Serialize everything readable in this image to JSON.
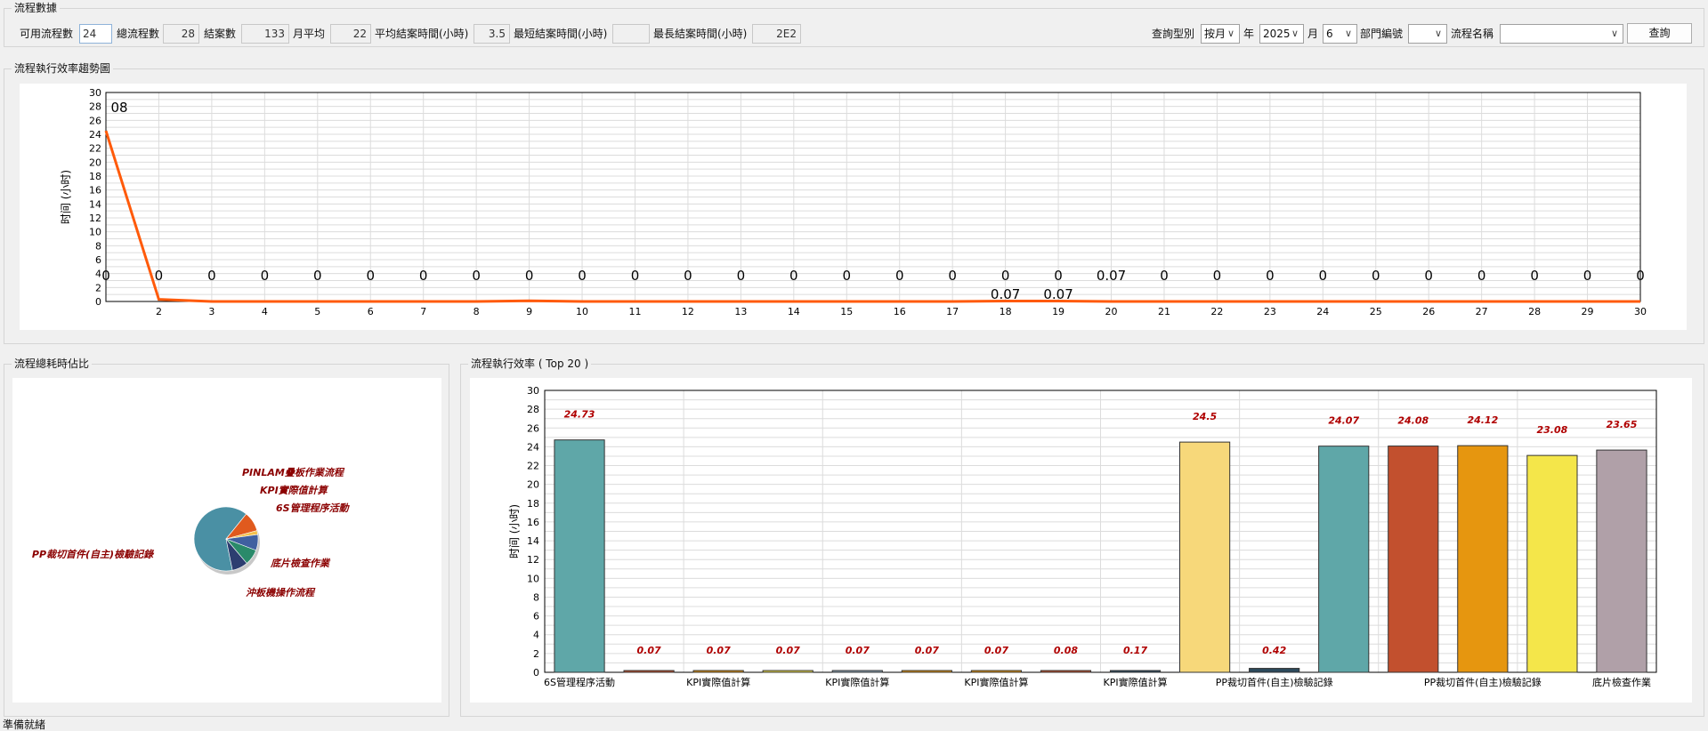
{
  "stats": {
    "title": "流程數據",
    "available_label": "可用流程數",
    "available_value": "24",
    "total_label": "總流程數",
    "total_value": "28",
    "closed_label": "結案數",
    "closed_value": "133",
    "monthly_label": "月平均",
    "monthly_value": "22",
    "avg_label": "平均結案時間(小時)",
    "avg_value": "3.5",
    "min_label": "最短結案時間(小時)",
    "min_value": "",
    "max_label": "最長結案時間(小時)",
    "max_value": "2E2"
  },
  "query": {
    "type_label": "查詢型別",
    "type_value": "按月",
    "year_label": "年",
    "year_value": "2025",
    "month_label": "月",
    "month_value": "6",
    "dept_label": "部門編號",
    "dept_value": "",
    "name_label": "流程名稱",
    "name_value": "",
    "search_button": "查詢"
  },
  "trend_section": {
    "title": "流程執行效率趨勢圖"
  },
  "pie_section": {
    "title": "流程總耗時佔比"
  },
  "bar_section": {
    "title": "流程執行效率 ( Top 20 )"
  },
  "status_bar": {
    "text": "準備就緒"
  },
  "chart_data": [
    {
      "type": "line",
      "ylabel": "时间 (小时)",
      "ylim": [
        0,
        30
      ],
      "yticks": [
        0,
        2,
        4,
        6,
        8,
        10,
        12,
        14,
        16,
        18,
        20,
        22,
        24,
        26,
        28,
        30
      ],
      "x_tick_labels": [
        "2",
        "3",
        "4",
        "5",
        "6",
        "7",
        "8",
        "9",
        "10",
        "11",
        "12",
        "13",
        "14",
        "15",
        "16",
        "17",
        "18",
        "19",
        "20",
        "21",
        "22",
        "23",
        "24",
        "25",
        "26",
        "27",
        "28",
        "29",
        "30"
      ],
      "grid": true,
      "color": "#ff5a0a",
      "x": [
        1,
        2,
        3,
        4,
        5,
        6,
        7,
        8,
        9,
        10,
        11,
        12,
        13,
        14,
        15,
        16,
        17,
        18,
        19,
        20,
        21,
        22,
        23,
        24,
        25,
        26,
        27,
        28,
        29,
        30
      ],
      "values": [
        24.5,
        0.3,
        0,
        0,
        0,
        0,
        0,
        0,
        0.1,
        0,
        0,
        0,
        0,
        0,
        0,
        0,
        0,
        0.07,
        0.07,
        0,
        0,
        0,
        0,
        0,
        0,
        0,
        0,
        0,
        0,
        0
      ],
      "point_labels": [
        {
          "x": 1,
          "text": "08",
          "pos": "high"
        },
        {
          "x": 1,
          "text": "0",
          "pos": "mid"
        },
        {
          "x": 2,
          "text": "0",
          "pos": "mid"
        },
        {
          "x": 3,
          "text": "0",
          "pos": "mid"
        },
        {
          "x": 4,
          "text": "0",
          "pos": "mid"
        },
        {
          "x": 5,
          "text": "0",
          "pos": "mid"
        },
        {
          "x": 6,
          "text": "0",
          "pos": "mid"
        },
        {
          "x": 7,
          "text": "0",
          "pos": "mid"
        },
        {
          "x": 8,
          "text": "0",
          "pos": "mid"
        },
        {
          "x": 9,
          "text": "0",
          "pos": "mid"
        },
        {
          "x": 10,
          "text": "0",
          "pos": "mid"
        },
        {
          "x": 11,
          "text": "0",
          "pos": "mid"
        },
        {
          "x": 12,
          "text": "0",
          "pos": "mid"
        },
        {
          "x": 13,
          "text": "0",
          "pos": "mid"
        },
        {
          "x": 14,
          "text": "0",
          "pos": "mid"
        },
        {
          "x": 15,
          "text": "0",
          "pos": "mid"
        },
        {
          "x": 16,
          "text": "0",
          "pos": "mid"
        },
        {
          "x": 17,
          "text": "0",
          "pos": "mid"
        },
        {
          "x": 18,
          "text": "0",
          "pos": "mid"
        },
        {
          "x": 19,
          "text": "0",
          "pos": "mid"
        },
        {
          "x": 20,
          "text": "0.07",
          "pos": "mid"
        },
        {
          "x": 21,
          "text": "0",
          "pos": "mid"
        },
        {
          "x": 22,
          "text": "0",
          "pos": "mid"
        },
        {
          "x": 23,
          "text": "0",
          "pos": "mid"
        },
        {
          "x": 24,
          "text": "0",
          "pos": "mid"
        },
        {
          "x": 25,
          "text": "0",
          "pos": "mid"
        },
        {
          "x": 26,
          "text": "0",
          "pos": "mid"
        },
        {
          "x": 27,
          "text": "0",
          "pos": "mid"
        },
        {
          "x": 28,
          "text": "0",
          "pos": "mid"
        },
        {
          "x": 29,
          "text": "0",
          "pos": "mid"
        },
        {
          "x": 30,
          "text": "0",
          "pos": "mid"
        },
        {
          "x": 18,
          "text": "0.07",
          "pos": "low"
        },
        {
          "x": 19,
          "text": "0.07",
          "pos": "low"
        }
      ]
    },
    {
      "type": "pie",
      "label_color": "#8b0000",
      "slices": [
        {
          "label": "PP裁切首件(自主)檢驗記錄",
          "value": 64,
          "color": "#4a90a4"
        },
        {
          "label": "PINLAM疊板作業流程",
          "value": 10,
          "color": "#e05a1e"
        },
        {
          "label": "KPI實際值計算",
          "value": 2,
          "color": "#f2c14e"
        },
        {
          "label": "6S管理程序活動",
          "value": 8,
          "color": "#4060a0"
        },
        {
          "label": "底片檢查作業",
          "value": 8,
          "color": "#2a8a6a"
        },
        {
          "label": "沖板機操作流程",
          "value": 8,
          "color": "#2c3e70"
        }
      ]
    },
    {
      "type": "bar",
      "ylabel": "时间 (小时)",
      "ylim": [
        0,
        30
      ],
      "yticks": [
        0,
        2,
        4,
        6,
        8,
        10,
        12,
        14,
        16,
        18,
        20,
        22,
        24,
        26,
        28,
        30
      ],
      "grid": true,
      "x_tick_labels": [
        {
          "after_bar": 0,
          "text": "6S管理程序活動"
        },
        {
          "after_bar": 2,
          "text": "KPI實際值計算"
        },
        {
          "after_bar": 4,
          "text": "KPI實際值計算"
        },
        {
          "after_bar": 6,
          "text": "KPI實際值計算"
        },
        {
          "after_bar": 8,
          "text": "KPI實際值計算"
        },
        {
          "after_bar": 10,
          "text": "PP裁切首件(自主)檢驗記錄"
        },
        {
          "after_bar": 13,
          "text": "PP裁切首件(自主)檢驗記錄"
        },
        {
          "after_bar": 15,
          "text": "底片檢查作業"
        }
      ],
      "values": [
        24.73,
        0.07,
        0.07,
        0.07,
        0.07,
        0.07,
        0.07,
        0.08,
        0.17,
        24.5,
        0.42,
        24.07,
        24.08,
        24.12,
        23.08,
        23.65
      ],
      "value_labels": [
        "24.73",
        "0.07",
        "0.07",
        "0.07",
        "0.07",
        "0.07",
        "0.07",
        "0.08",
        "0.17",
        "24.5",
        "0.42",
        "24.07",
        "24.08",
        "24.12",
        "23.08",
        "23.65"
      ],
      "colors": [
        "#5fa7a8",
        "#c2502e",
        "#e6960f",
        "#f0e04a",
        "#8aa0b0",
        "#e6960f",
        "#e6960f",
        "#c2502e",
        "#2c4a5c",
        "#f7d87a",
        "#2c4a5c",
        "#5fa7a8",
        "#c2502e",
        "#e6960f",
        "#f4e64a",
        "#b0a0a8"
      ]
    }
  ]
}
